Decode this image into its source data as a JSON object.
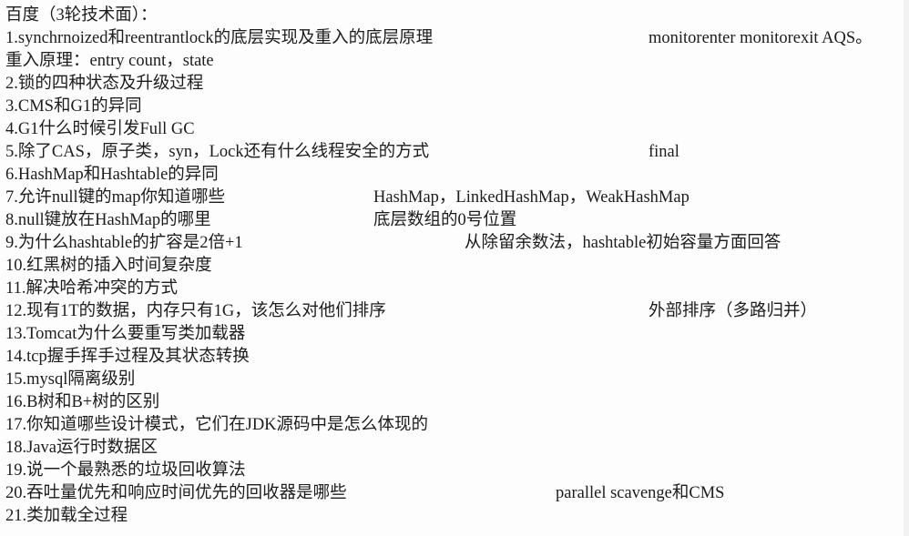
{
  "header": "百度（3轮技术面）：",
  "lines": [
    {
      "q": "1.synchrnoized和reentrantlock的底层实现及重入的底层原理",
      "a": "monitorenter monitorexit AQS。"
    },
    {
      "q": "重入原理：entry count，state",
      "a": ""
    },
    {
      "q": "2.锁的四种状态及升级过程",
      "a": ""
    },
    {
      "q": "3.CMS和G1的异同",
      "a": ""
    },
    {
      "q": "4.G1什么时候引发Full GC",
      "a": ""
    },
    {
      "q": "5.除了CAS，原子类，syn，Lock还有什么线程安全的方式",
      "a": "final"
    },
    {
      "q": "6.HashMap和Hashtable的异同",
      "a": ""
    },
    {
      "q": "7.允许null键的map你知道哪些",
      "a": "HashMap，LinkedHashMap，WeakHashMap"
    },
    {
      "q": "8.null键放在HashMap的哪里",
      "a": "底层数组的0号位置"
    },
    {
      "q": "9.为什么hashtable的扩容是2倍+1",
      "a": "从除留余数法，hashtable初始容量方面回答"
    },
    {
      "q": "10.红黑树的插入时间复杂度",
      "a": ""
    },
    {
      "q": "11.解决哈希冲突的方式",
      "a": ""
    },
    {
      "q": "12.现有1T的数据，内存只有1G，该怎么对他们排序",
      "a": "外部排序（多路归并）"
    },
    {
      "q": "13.Tomcat为什么要重写类加载器",
      "a": ""
    },
    {
      "q": "14.tcp握手挥手过程及其状态转换",
      "a": ""
    },
    {
      "q": "15.mysql隔离级别",
      "a": ""
    },
    {
      "q": "16.B树和B+树的区别",
      "a": ""
    },
    {
      "q": "17.你知道哪些设计模式，它们在JDK源码中是怎么体现的",
      "a": ""
    },
    {
      "q": "18.Java运行时数据区",
      "a": ""
    },
    {
      "q": "19.说一个最熟悉的垃圾回收算法",
      "a": ""
    },
    {
      "q": "20.吞吐量优先和响应时间优先的回收器是哪些",
      "a": "parallel scavenge和CMS"
    },
    {
      "q": "21.类加载全过程",
      "a": ""
    }
  ]
}
